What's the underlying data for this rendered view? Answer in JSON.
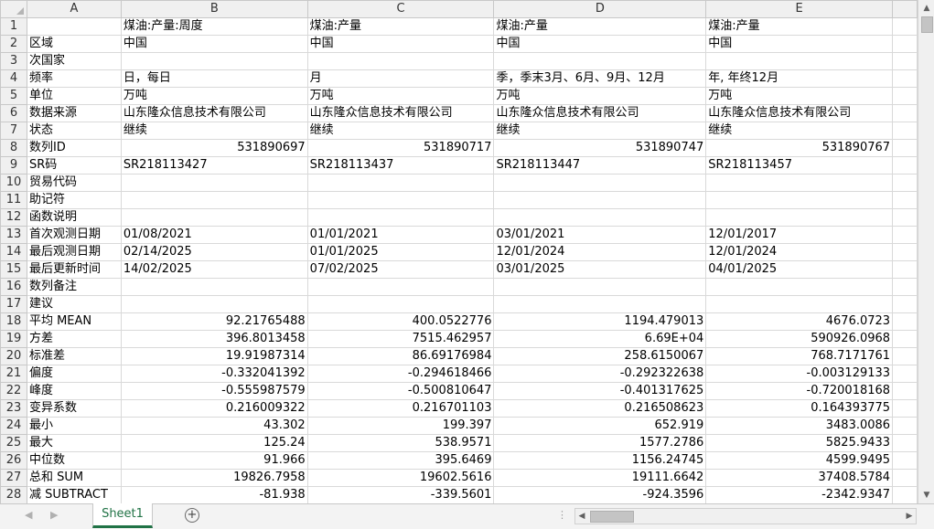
{
  "columns": [
    "A",
    "B",
    "C",
    "D",
    "E"
  ],
  "rows": [
    {
      "n": "1",
      "a": "",
      "b": "煤油:产量:周度",
      "c": "煤油:产量",
      "d": "煤油:产量",
      "e": "煤油:产量"
    },
    {
      "n": "2",
      "a": "区域",
      "b": "中国",
      "c": "中国",
      "d": "中国",
      "e": "中国"
    },
    {
      "n": "3",
      "a": "次国家",
      "b": "",
      "c": "",
      "d": "",
      "e": ""
    },
    {
      "n": "4",
      "a": "频率",
      "b": "日，每日",
      "c": "月",
      "d": "季，季末3月、6月、9月、12月",
      "e": "年, 年终12月"
    },
    {
      "n": "5",
      "a": "单位",
      "b": "万吨",
      "c": "万吨",
      "d": "万吨",
      "e": "万吨"
    },
    {
      "n": "6",
      "a": "数据来源",
      "b": "山东隆众信息技术有限公司",
      "c": "山东隆众信息技术有限公司",
      "d": "山东隆众信息技术有限公司",
      "e": "山东隆众信息技术有限公司"
    },
    {
      "n": "7",
      "a": "状态",
      "b": "继续",
      "c": "继续",
      "d": "继续",
      "e": "继续"
    },
    {
      "n": "8",
      "a": "数列ID",
      "b": "531890697",
      "c": "531890717",
      "d": "531890747",
      "e": "531890767",
      "num": true
    },
    {
      "n": "9",
      "a": "SR码",
      "b": "SR218113427",
      "c": "SR218113437",
      "d": "SR218113447",
      "e": "SR218113457"
    },
    {
      "n": "10",
      "a": "贸易代码",
      "b": "",
      "c": "",
      "d": "",
      "e": ""
    },
    {
      "n": "11",
      "a": "助记符",
      "b": "",
      "c": "",
      "d": "",
      "e": ""
    },
    {
      "n": "12",
      "a": "函数说明",
      "b": "",
      "c": "",
      "d": "",
      "e": ""
    },
    {
      "n": "13",
      "a": "首次观测日期",
      "b": "01/08/2021",
      "c": "01/01/2021",
      "d": "03/01/2021",
      "e": "12/01/2017"
    },
    {
      "n": "14",
      "a": "最后观测日期",
      "b": "02/14/2025",
      "c": "01/01/2025",
      "d": "12/01/2024",
      "e": "12/01/2024"
    },
    {
      "n": "15",
      "a": "最后更新时间",
      "b": "14/02/2025",
      "c": "07/02/2025",
      "d": "03/01/2025",
      "e": "04/01/2025"
    },
    {
      "n": "16",
      "a": "数列备注",
      "b": "",
      "c": "",
      "d": "",
      "e": ""
    },
    {
      "n": "17",
      "a": "建议",
      "b": "",
      "c": "",
      "d": "",
      "e": ""
    },
    {
      "n": "18",
      "a": "平均 MEAN",
      "b": "92.21765488",
      "c": "400.0522776",
      "d": "1194.479013",
      "e": "4676.0723",
      "num": true
    },
    {
      "n": "19",
      "a": "方差",
      "b": "396.8013458",
      "c": "7515.462957",
      "d": "6.69E+04",
      "e": "590926.0968",
      "num": true
    },
    {
      "n": "20",
      "a": "标准差",
      "b": "19.91987314",
      "c": "86.69176984",
      "d": "258.6150067",
      "e": "768.7171761",
      "num": true
    },
    {
      "n": "21",
      "a": "偏度",
      "b": "-0.332041392",
      "c": "-0.294618466",
      "d": "-0.292322638",
      "e": "-0.003129133",
      "num": true
    },
    {
      "n": "22",
      "a": "峰度",
      "b": "-0.555987579",
      "c": "-0.500810647",
      "d": "-0.401317625",
      "e": "-0.720018168",
      "num": true
    },
    {
      "n": "23",
      "a": "变异系数",
      "b": "0.216009322",
      "c": "0.216701103",
      "d": "0.216508623",
      "e": "0.164393775",
      "num": true
    },
    {
      "n": "24",
      "a": "最小",
      "b": "43.302",
      "c": "199.397",
      "d": "652.919",
      "e": "3483.0086",
      "num": true
    },
    {
      "n": "25",
      "a": "最大",
      "b": "125.24",
      "c": "538.9571",
      "d": "1577.2786",
      "e": "5825.9433",
      "num": true
    },
    {
      "n": "26",
      "a": "中位数",
      "b": "91.966",
      "c": "395.6469",
      "d": "1156.24745",
      "e": "4599.9495",
      "num": true
    },
    {
      "n": "27",
      "a": "总和 SUM",
      "b": "19826.7958",
      "c": "19602.5616",
      "d": "19111.6642",
      "e": "37408.5784",
      "num": true
    },
    {
      "n": "28",
      "a": "减 SUBTRACT",
      "b": "-81.938",
      "c": "-339.5601",
      "d": "-924.3596",
      "e": "-2342.9347",
      "num": true
    }
  ],
  "tabs": {
    "sheet1": "Sheet1",
    "add": "+"
  },
  "icons": {
    "scroll_up": "▲",
    "scroll_down": "▼",
    "scroll_left": "◀",
    "scroll_right": "▶",
    "tab_prev": "◀",
    "tab_next": "▶",
    "separator": "⋮"
  },
  "colors": {
    "accent": "#217346",
    "header_bg": "#f0f0f0",
    "grid": "#d9d9d9"
  }
}
